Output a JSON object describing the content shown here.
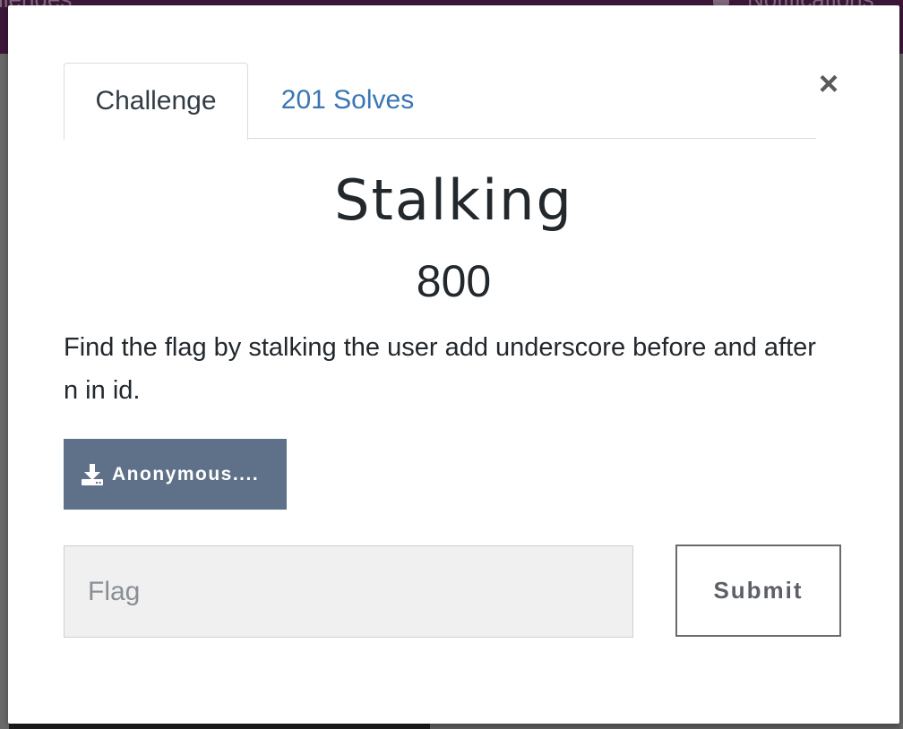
{
  "background": {
    "left_text": "llenges",
    "right_text": "Notifications"
  },
  "modal": {
    "tabs": [
      {
        "label": "Challenge",
        "active": true
      },
      {
        "label": "201 Solves",
        "active": false
      }
    ],
    "close_symbol": "×",
    "challenge": {
      "name": "Stalking",
      "points": "800",
      "description": "Find the flag by stalking the user add underscore before and after n in id."
    },
    "file": {
      "icon": "download-icon",
      "label": "Anonymous...."
    },
    "flag_input": {
      "value": "",
      "placeholder": "Flag"
    },
    "submit_label": "Submit"
  },
  "colors": {
    "topbar": "#3c1739",
    "tab_link": "#3a76b4",
    "file_button": "#5e7189",
    "text": "#23282d"
  }
}
